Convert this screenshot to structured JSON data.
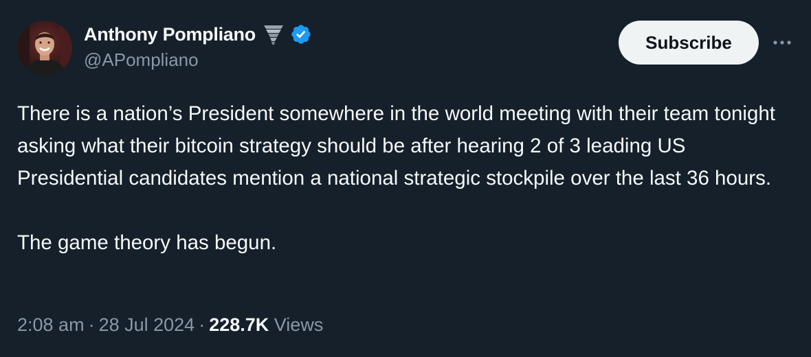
{
  "author": {
    "display_name": "Anthony Pompliano",
    "handle": "@APompliano",
    "badge_emoji_icon": "tornado-icon",
    "verified_icon": "verified-badge-icon",
    "verified_color": "#1d9bf0"
  },
  "actions": {
    "subscribe_label": "Subscribe",
    "more_icon": "more-horizontal-icon"
  },
  "tweet": {
    "paragraphs": [
      "There is a nation’s President somewhere in the world meeting with their team tonight asking what their bitcoin strategy should be after hearing 2 of 3 leading US Presidential candidates mention a national strategic stockpile over the last 36 hours.",
      "The game theory has begun."
    ]
  },
  "meta": {
    "time": "2:08 am",
    "separator": "·",
    "date": "28 Jul 2024",
    "views_count": "228.7K",
    "views_label": "Views"
  },
  "colors": {
    "background": "#15202b",
    "primary_text": "#f7f9f9",
    "secondary_text": "#8b98a5",
    "button_bg": "#eff3f4",
    "button_text": "#0f1419"
  }
}
